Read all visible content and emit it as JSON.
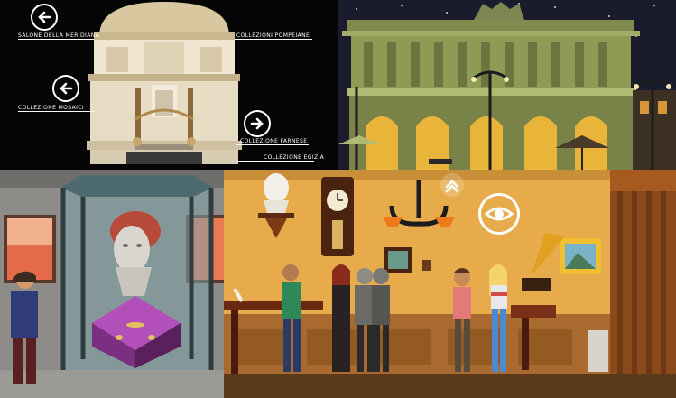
{
  "museum_map": {
    "nav": [
      {
        "label": "SALONE DELLA MERIDIANA",
        "icon": "arrow-left-icon"
      },
      {
        "label": "COLLEZIONI POMPEIANE",
        "icon": null
      },
      {
        "label": "COLLEZIONE MOSAICI",
        "icon": "arrow-left-icon"
      },
      {
        "label": "COLLEZIONE FARNESE",
        "icon": "arrow-right-icon"
      },
      {
        "label": "COLLEZIONE EGIZIA",
        "icon": null
      }
    ]
  },
  "scene_icons": {
    "eye": "eye-icon",
    "up": "chevron-up-icon"
  },
  "colors": {
    "night_sky": "#15182a",
    "museum_facade": "#8f9a55",
    "interior_wall": "#e6a94a",
    "black_bg": "#050505"
  }
}
